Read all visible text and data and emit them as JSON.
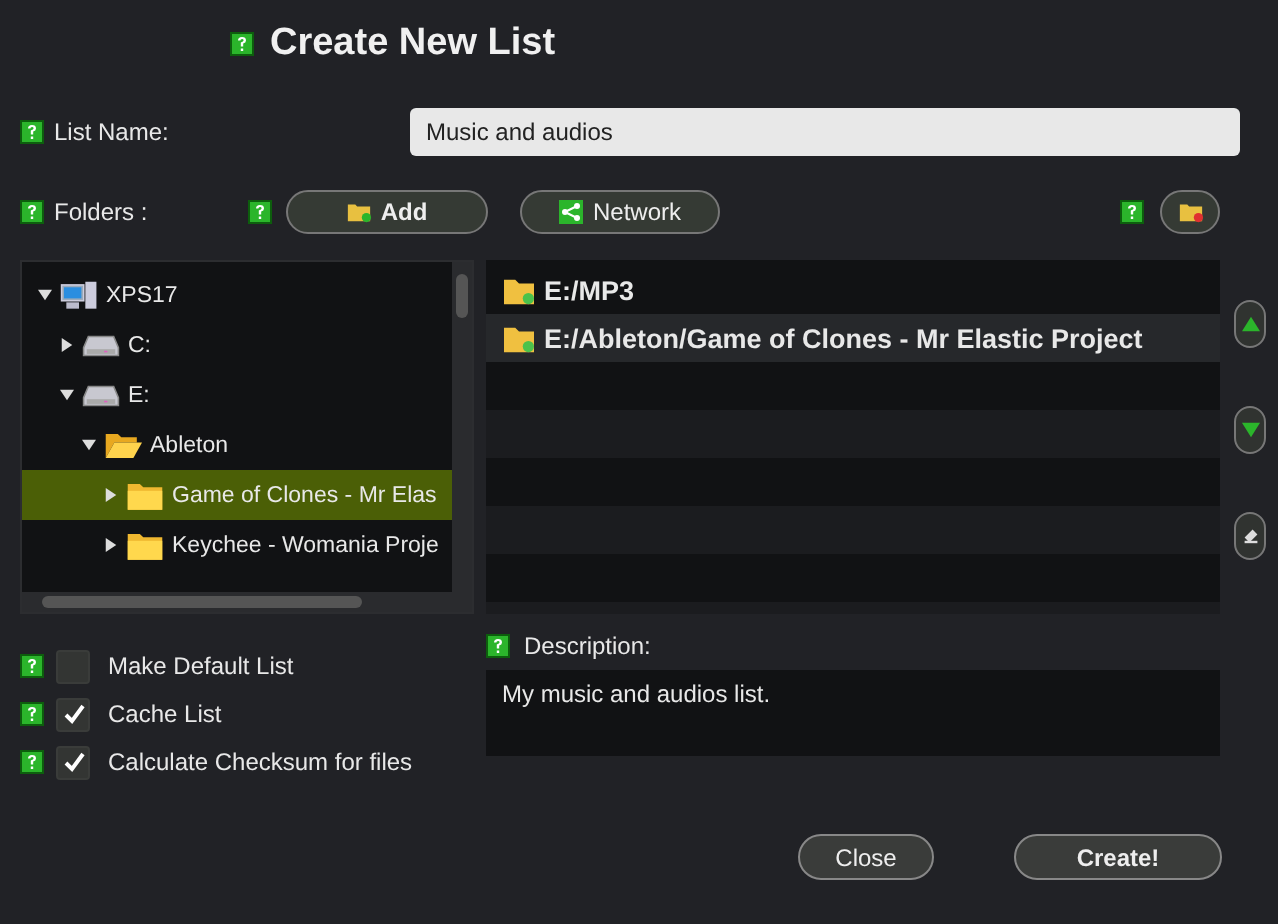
{
  "title": "Create New List",
  "list_name": {
    "label": "List Name:",
    "value": "Music and audios"
  },
  "folders": {
    "label": "Folders :",
    "buttons": [
      {
        "kind": "add",
        "label": "Add"
      },
      {
        "kind": "network",
        "label": "Network"
      }
    ]
  },
  "tree": [
    {
      "label": "XPS17",
      "kind": "computer",
      "expanded": true,
      "selected": false,
      "children": [
        {
          "label": "C:",
          "kind": "drive",
          "expanded": false,
          "selected": false
        },
        {
          "label": "E:",
          "kind": "drive",
          "expanded": true,
          "selected": false,
          "children": [
            {
              "label": "Ableton",
              "kind": "folder",
              "expanded": true,
              "selected": false,
              "children": [
                {
                  "label": "Game of Clones - Mr Elas",
                  "kind": "folder",
                  "expanded": false,
                  "selected": true
                },
                {
                  "label": "Keychee - Womania Proje",
                  "kind": "folder",
                  "expanded": false,
                  "selected": false
                }
              ]
            }
          ]
        }
      ]
    }
  ],
  "selected_folders": [
    {
      "path": "E:/MP3",
      "selected": false
    },
    {
      "path": "E:/Ableton/Game of Clones - Mr Elastic Project",
      "selected": true
    }
  ],
  "options": [
    {
      "label": "Make Default List",
      "checked": false
    },
    {
      "label": "Cache List",
      "checked": true
    },
    {
      "label": "Calculate Checksum for files",
      "checked": true
    }
  ],
  "description": {
    "label": "Description:",
    "value": "My music and audios list."
  },
  "buttons": [
    {
      "kind": "close",
      "label": "Close"
    },
    {
      "kind": "primary",
      "label": "Create!"
    }
  ]
}
